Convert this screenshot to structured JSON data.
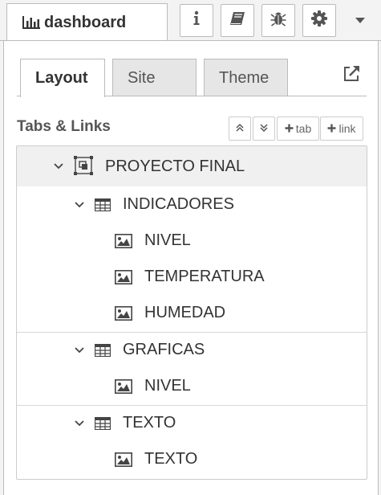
{
  "sidebar": {
    "active_tab_label": "dashboard",
    "tab_icon": "bar-chart-icon",
    "buttons": [
      {
        "icon": "info-icon"
      },
      {
        "icon": "book-icon"
      },
      {
        "icon": "bug-icon"
      },
      {
        "icon": "gear-icon"
      }
    ],
    "dropdown_icon": "caret-down-icon"
  },
  "subtabs": [
    {
      "label": "Layout",
      "active": true
    },
    {
      "label": "Site",
      "active": false
    },
    {
      "label": "Theme",
      "active": false
    }
  ],
  "external_link_icon": "external-link-icon",
  "section": {
    "title": "Tabs & Links",
    "buttons": {
      "collapse_icon": "double-chevron-up-icon",
      "expand_icon": "double-chevron-down-icon",
      "add_tab": "tab",
      "add_link": "link"
    }
  },
  "tree": {
    "root": {
      "label": "PROYECTO FINAL",
      "icon": "tab-icon"
    },
    "groups": [
      {
        "label": "INDICADORES",
        "icon": "table-icon",
        "widgets": [
          {
            "label": "NIVEL",
            "icon": "image-icon"
          },
          {
            "label": "TEMPERATURA",
            "icon": "image-icon"
          },
          {
            "label": "HUMEDAD",
            "icon": "image-icon"
          }
        ]
      },
      {
        "label": "GRAFICAS",
        "icon": "table-icon",
        "widgets": [
          {
            "label": "NIVEL",
            "icon": "image-icon"
          }
        ]
      },
      {
        "label": "TEXTO",
        "icon": "table-icon",
        "widgets": [
          {
            "label": "TEXTO",
            "icon": "image-icon"
          }
        ]
      }
    ]
  },
  "colors": {
    "border": "#bbbbbb",
    "panel_bg": "#f3f3f3",
    "root_row_bg": "#f0f0f0",
    "inactive_tab_bg": "#e6e6e6"
  }
}
